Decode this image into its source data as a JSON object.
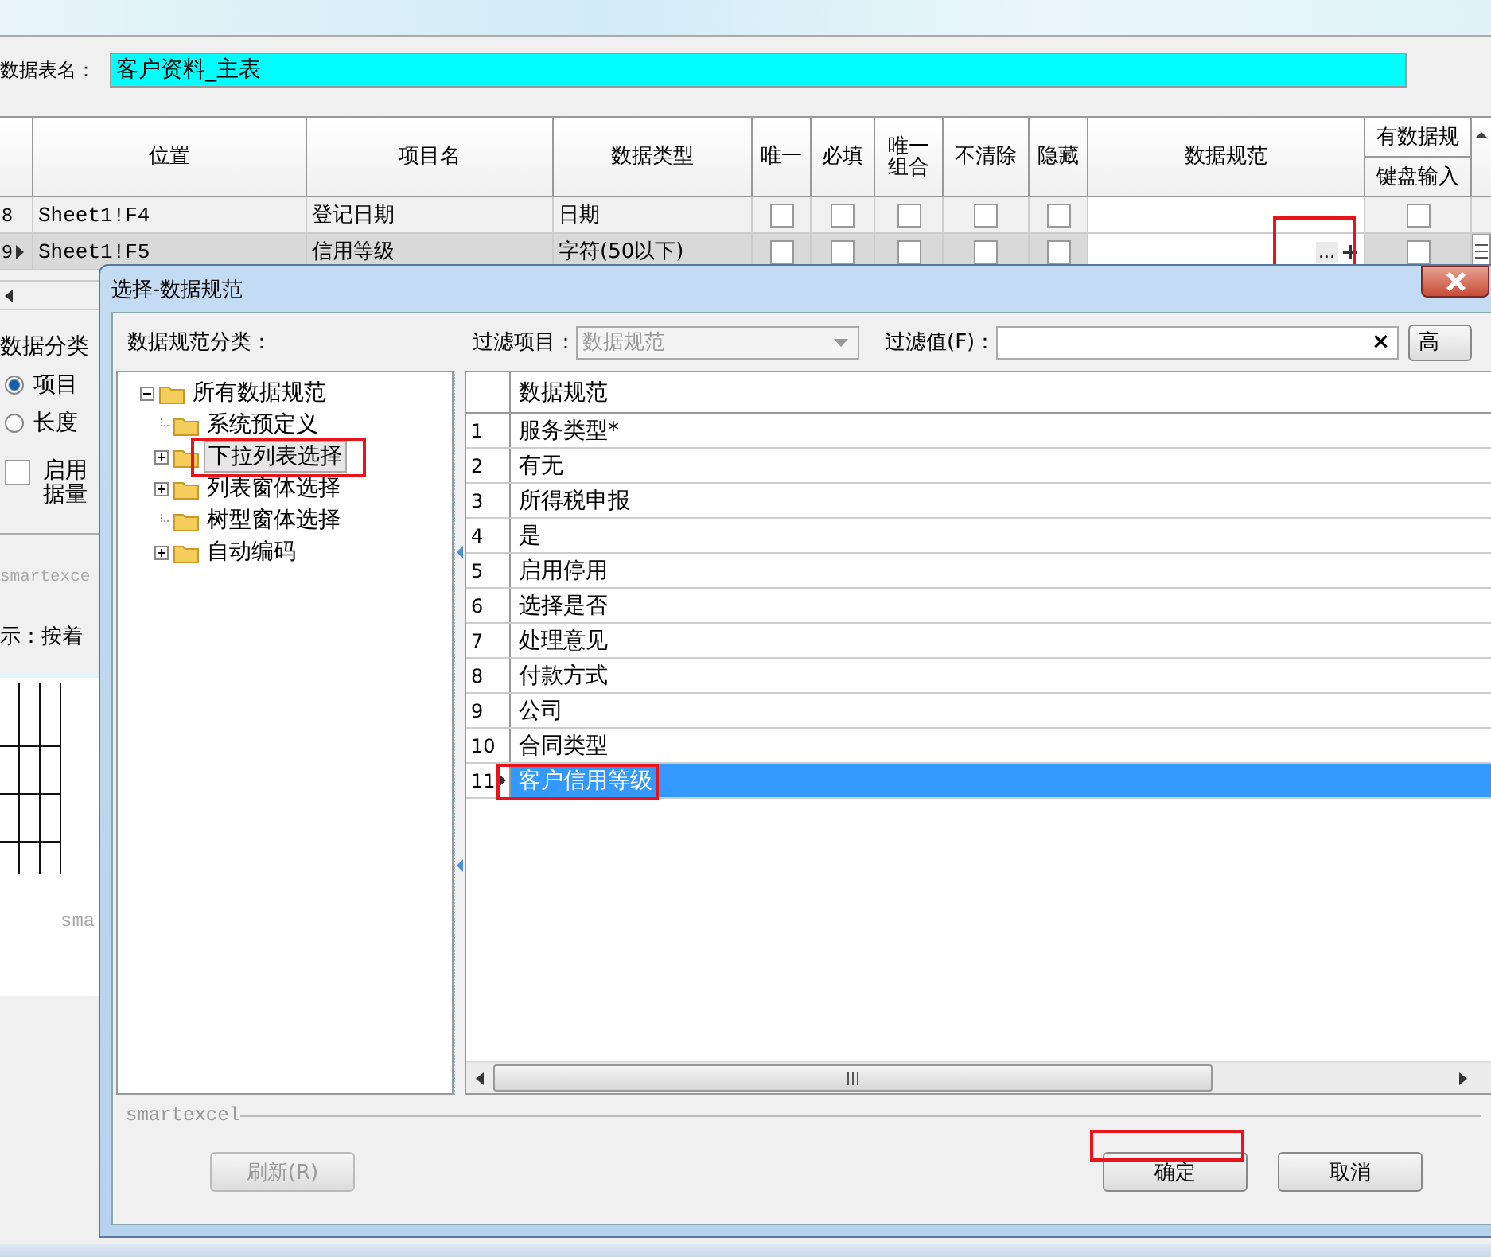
{
  "table_name": {
    "label": "数据表名：",
    "value": "客户资料_主表"
  },
  "grid": {
    "columns": [
      {
        "label": "位置",
        "kind": "text"
      },
      {
        "label": "项目名",
        "kind": "text"
      },
      {
        "label": "数据类型",
        "kind": "text"
      },
      {
        "label": "唯一",
        "kind": "check"
      },
      {
        "label": "必填",
        "kind": "check"
      },
      {
        "label": "唯一组合",
        "kind": "check"
      },
      {
        "label": "不清除",
        "kind": "check"
      },
      {
        "label": "隐藏",
        "kind": "check"
      },
      {
        "label": "数据规范",
        "kind": "spec"
      },
      {
        "label": "有数据规",
        "sub_label": "键盘输入",
        "kind": "check"
      }
    ],
    "rows": [
      {
        "number": "8",
        "selected": false,
        "values": [
          "Sheet1!F4",
          "登记日期",
          "日期",
          false,
          false,
          false,
          false,
          false,
          false
        ],
        "annotated": false
      },
      {
        "number": "9",
        "selected": true,
        "values": [
          "Sheet1!F5",
          "信用等级",
          "字符(50以下)",
          false,
          false,
          false,
          false,
          false,
          false
        ],
        "spec_button": "...",
        "annotated": true
      }
    ]
  },
  "background_panel": {
    "group_label": "数据分类",
    "radios": [
      {
        "label": "项目",
        "selected": true
      },
      {
        "label": "长度",
        "selected": false
      }
    ],
    "checkbox": {
      "lines": [
        "启用",
        "据量"
      ],
      "checked": false
    },
    "caption": "smartexce",
    "hint": "示：按着",
    "preview_caption": "sma"
  },
  "dialog": {
    "title": "选择-数据规范",
    "category_label": "数据规范分类：",
    "filter_item_label": "过滤项目：",
    "filter_item_value": "数据规范",
    "filter_value_label": "过滤值(F)：",
    "clear_glyph": "×",
    "advanced_button": "高",
    "tree": [
      {
        "label": "所有数据规范",
        "expanded": true,
        "selected": false,
        "annotated": false,
        "children": [
          {
            "label": "系统预定义",
            "expandable": false,
            "selected": false,
            "annotated": false
          },
          {
            "label": "下拉列表选择",
            "expandable": true,
            "selected": true,
            "annotated": true
          },
          {
            "label": "列表窗体选择",
            "expandable": true,
            "selected": false,
            "annotated": false
          },
          {
            "label": "树型窗体选择",
            "expandable": false,
            "selected": false,
            "annotated": false
          },
          {
            "label": "自动编码",
            "expandable": true,
            "selected": false,
            "annotated": false
          }
        ]
      }
    ],
    "list": {
      "column": "数据规范",
      "rows": [
        {
          "number": "1",
          "text": "服务类型*",
          "selected": false,
          "annotated": false
        },
        {
          "number": "2",
          "text": "有无",
          "selected": false,
          "annotated": false
        },
        {
          "number": "3",
          "text": "所得税申报",
          "selected": false,
          "annotated": false
        },
        {
          "number": "4",
          "text": "是",
          "selected": false,
          "annotated": false
        },
        {
          "number": "5",
          "text": "启用停用",
          "selected": false,
          "annotated": false
        },
        {
          "number": "6",
          "text": "选择是否",
          "selected": false,
          "annotated": false
        },
        {
          "number": "7",
          "text": "处理意见",
          "selected": false,
          "annotated": false
        },
        {
          "number": "8",
          "text": "付款方式",
          "selected": false,
          "annotated": false
        },
        {
          "number": "9",
          "text": "公司",
          "selected": false,
          "annotated": false
        },
        {
          "number": "10",
          "text": "合同类型",
          "selected": false,
          "annotated": false
        },
        {
          "number": "11",
          "text": "客户信用等级",
          "selected": true,
          "annotated": true
        }
      ]
    },
    "caption": "smartexcel",
    "buttons": [
      {
        "label": "刷新(R)",
        "kind": "refresh",
        "disabled": true,
        "annotated": false
      },
      {
        "label": "确定",
        "kind": "ok",
        "disabled": false,
        "annotated": true
      },
      {
        "label": "取消",
        "kind": "cancel",
        "disabled": false,
        "annotated": false
      }
    ]
  }
}
